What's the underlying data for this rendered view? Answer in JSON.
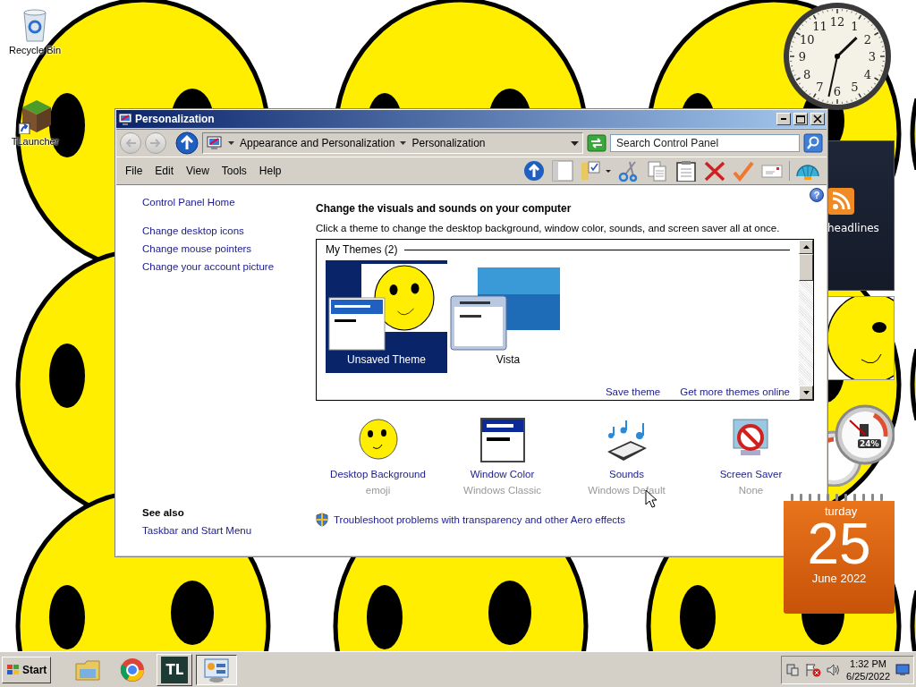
{
  "desktop_icons": [
    {
      "kind": "recycle-bin",
      "label": "Recycle Bin"
    },
    {
      "kind": "shortcut",
      "label": "TLauncher"
    }
  ],
  "window": {
    "title": "Personalization",
    "address": {
      "crumbs": [
        "Appearance and Personalization",
        "Personalization"
      ],
      "search_placeholder": "Search Control Panel"
    },
    "menu": [
      "File",
      "Edit",
      "View",
      "Tools",
      "Help"
    ],
    "help": "?",
    "left_pane": {
      "links": [
        "Control Panel Home",
        "Change desktop icons",
        "Change mouse pointers",
        "Change your account picture"
      ],
      "see_also_heading": "See also",
      "see_also_links": [
        "Taskbar and Start Menu"
      ]
    },
    "main": {
      "heading": "Change the visuals and sounds on your computer",
      "description": "Click a theme to change the desktop background, window color, sounds, and screen saver all at once.",
      "themes_group": "My Themes (2)",
      "themes": [
        {
          "name": "Unsaved Theme",
          "kind": "emoji",
          "selected": true
        },
        {
          "name": "Vista",
          "kind": "photo",
          "selected": false
        }
      ],
      "theme_links": [
        "Save theme",
        "Get more themes online"
      ],
      "settings": [
        {
          "kind": "background",
          "label": "Desktop Background",
          "value": "emoji"
        },
        {
          "kind": "color",
          "label": "Window Color",
          "value": "Windows Classic"
        },
        {
          "kind": "sounds",
          "label": "Sounds",
          "value": "Windows Default"
        },
        {
          "kind": "screensaver",
          "label": "Screen Saver",
          "value": "None"
        }
      ],
      "troubleshoot": "Troubleshoot problems with transparency and other Aero effects"
    }
  },
  "gadgets": {
    "clock_numerals": [
      "12",
      "11",
      "1",
      "10",
      "2",
      "9",
      "3",
      "8",
      "4",
      "7",
      "5",
      "6"
    ],
    "feed_label": "headlines",
    "cpu_reading": "24%",
    "calendar": {
      "weekday": "turday",
      "day": "25",
      "month": "June 2022"
    }
  },
  "taskbar": {
    "start": "Start",
    "apps": [
      {
        "kind": "explorer",
        "active": false
      },
      {
        "kind": "browser",
        "active": false
      },
      {
        "kind": "tlauncher",
        "text": "TL",
        "active": false
      },
      {
        "kind": "control-panel",
        "active": true
      }
    ],
    "time": "1:32 PM",
    "date": "6/25/2022"
  }
}
